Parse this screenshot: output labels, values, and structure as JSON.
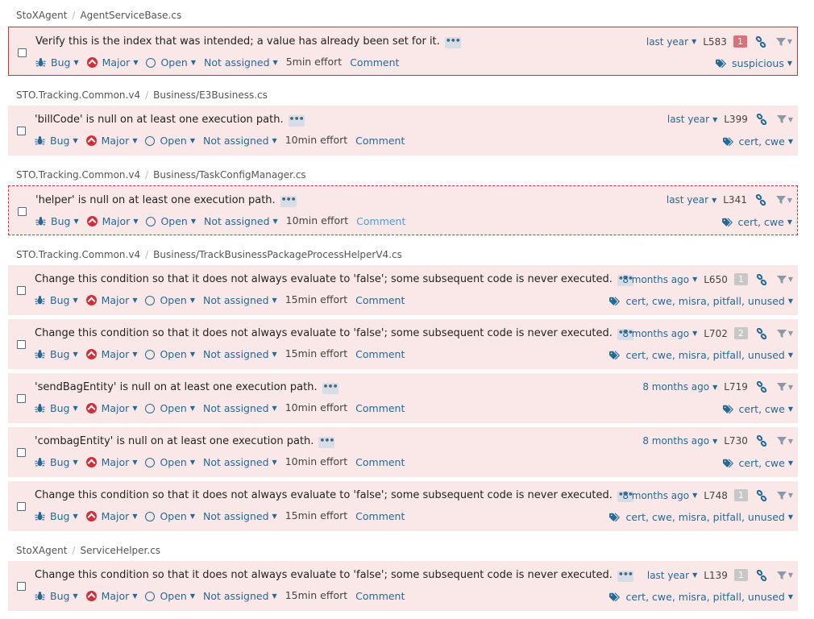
{
  "groups": [
    {
      "crumb": {
        "project": "StoXAgent",
        "file": "AgentServiceBase.cs"
      },
      "issues": [
        {
          "message": "Verify this is the index that was intended; a value has already been set for it.",
          "type": "Bug",
          "severity": "Major",
          "status": "Open",
          "assignee": "Not assigned",
          "effort": "5min effort",
          "comment": "Comment",
          "date": "last year",
          "line": "L583",
          "badge": "1",
          "badge_color": "red",
          "tags": "suspicious"
        }
      ]
    },
    {
      "crumb": {
        "project": "STO.Tracking.Common.v4",
        "file": "Business/E3Business.cs"
      },
      "issues": [
        {
          "message": "'billCode' is null on at least one execution path.",
          "type": "Bug",
          "severity": "Major",
          "status": "Open",
          "assignee": "Not assigned",
          "effort": "10min effort",
          "comment": "Comment",
          "date": "last year",
          "line": "L399",
          "badge": "",
          "tags": "cert, cwe"
        }
      ]
    },
    {
      "crumb": {
        "project": "STO.Tracking.Common.v4",
        "file": "Business/TaskConfigManager.cs"
      },
      "issues": [
        {
          "message": "'helper' is null on at least one execution path.",
          "type": "Bug",
          "severity": "Major",
          "status": "Open",
          "assignee": "Not assigned",
          "effort": "10min effort",
          "comment": "Comment",
          "date": "last year",
          "line": "L341",
          "badge": "",
          "tags": "cert, cwe"
        }
      ]
    },
    {
      "crumb": {
        "project": "STO.Tracking.Common.v4",
        "file": "Business/TrackBusinessPackageProcessHelperV4.cs"
      },
      "issues": [
        {
          "message": "Change this condition so that it does not always evaluate to 'false'; some subsequent code is never executed.",
          "type": "Bug",
          "severity": "Major",
          "status": "Open",
          "assignee": "Not assigned",
          "effort": "15min effort",
          "comment": "Comment",
          "date": "8 months ago",
          "line": "L650",
          "badge": "1",
          "badge_color": "grey",
          "tags": "cert, cwe, misra, pitfall, unused"
        },
        {
          "message": "Change this condition so that it does not always evaluate to 'false'; some subsequent code is never executed.",
          "type": "Bug",
          "severity": "Major",
          "status": "Open",
          "assignee": "Not assigned",
          "effort": "15min effort",
          "comment": "Comment",
          "date": "8 months ago",
          "line": "L702",
          "badge": "2",
          "badge_color": "grey",
          "tags": "cert, cwe, misra, pitfall, unused"
        },
        {
          "message": "'sendBagEntity' is null on at least one execution path.",
          "type": "Bug",
          "severity": "Major",
          "status": "Open",
          "assignee": "Not assigned",
          "effort": "10min effort",
          "comment": "Comment",
          "date": "8 months ago",
          "line": "L719",
          "badge": "",
          "tags": "cert, cwe"
        },
        {
          "message": "'combagEntity' is null on at least one execution path.",
          "type": "Bug",
          "severity": "Major",
          "status": "Open",
          "assignee": "Not assigned",
          "effort": "10min effort",
          "comment": "Comment",
          "date": "8 months ago",
          "line": "L730",
          "badge": "",
          "tags": "cert, cwe"
        },
        {
          "message": "Change this condition so that it does not always evaluate to 'false'; some subsequent code is never executed.",
          "type": "Bug",
          "severity": "Major",
          "status": "Open",
          "assignee": "Not assigned",
          "effort": "15min effort",
          "comment": "Comment",
          "date": "8 months ago",
          "line": "L748",
          "badge": "1",
          "badge_color": "grey",
          "tags": "cert, cwe, misra, pitfall, unused"
        }
      ]
    },
    {
      "crumb": {
        "project": "StoXAgent",
        "file": "ServiceHelper.cs"
      },
      "issues": [
        {
          "message": "Change this condition so that it does not always evaluate to 'false'; some subsequent code is never executed.",
          "type": "Bug",
          "severity": "Major",
          "status": "Open",
          "assignee": "Not assigned",
          "effort": "15min effort",
          "comment": "Comment",
          "date": "last year",
          "line": "L139",
          "badge": "1",
          "badge_color": "grey",
          "tags": "cert, cwe, misra, pitfall, unused"
        }
      ]
    }
  ],
  "colors": {
    "accent": "#236a97",
    "issue_bg": "#fae8e8",
    "severity_major": "#d02f3a"
  }
}
